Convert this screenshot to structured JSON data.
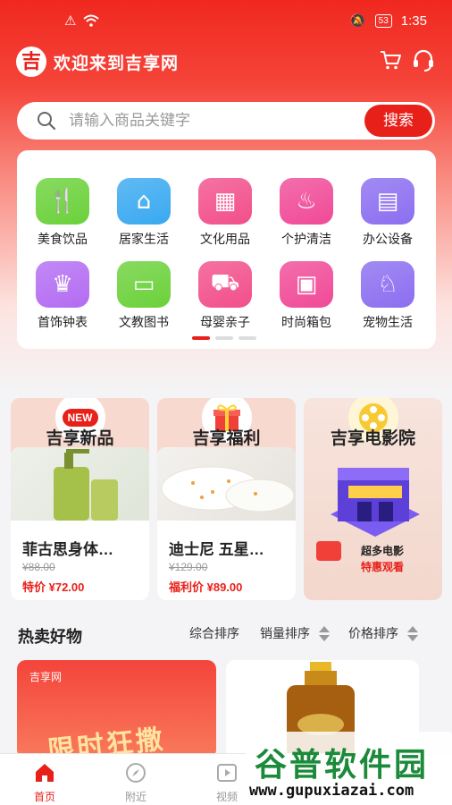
{
  "status": {
    "time": "1:35",
    "battery": "53"
  },
  "header": {
    "logo_char": "吉",
    "title": "欢迎来到吉享网"
  },
  "search": {
    "placeholder": "请输入商品关键字",
    "button": "搜索"
  },
  "categories": [
    {
      "label": "美食饮品",
      "icon": "utensils-icon",
      "color": "#6bd13a"
    },
    {
      "label": "居家生活",
      "icon": "home-icon",
      "color": "#39a9f0"
    },
    {
      "label": "文化用品",
      "icon": "calendar-icon",
      "color": "#f24f8a"
    },
    {
      "label": "个护清洁",
      "icon": "perfume-icon",
      "color": "#f04a97"
    },
    {
      "label": "办公设备",
      "icon": "office-icon",
      "color": "#8b6ef0"
    },
    {
      "label": "首饰钟表",
      "icon": "crown-icon",
      "color": "#b36cf2"
    },
    {
      "label": "文教图书",
      "icon": "book-icon",
      "color": "#6bd13a"
    },
    {
      "label": "母婴亲子",
      "icon": "stroller-icon",
      "color": "#f24f8a"
    },
    {
      "label": "时尚箱包",
      "icon": "luggage-icon",
      "color": "#f04a97"
    },
    {
      "label": "宠物生活",
      "icon": "pet-icon",
      "color": "#8b6ef0"
    }
  ],
  "promos": [
    {
      "title": "吉享新品",
      "badge": "NEW",
      "product": "菲古思身体…",
      "old_price": "¥88.00",
      "price": "特价 ¥72.00"
    },
    {
      "title": "吉享福利",
      "badge": "gift-icon",
      "product": "迪士尼 五星…",
      "old_price": "¥129.00",
      "price": "福利价 ¥89.00"
    },
    {
      "title": "吉享电影院",
      "badge": "film-reel-icon",
      "line1": "超多电影",
      "line2": "特惠观看"
    }
  ],
  "hot": {
    "title": "热卖好物",
    "sorts": [
      "综合排序",
      "销量排序",
      "价格排序"
    ],
    "banner_brand": "吉享网",
    "banner_text": "限时狂撒"
  },
  "tabs": [
    {
      "label": "首页",
      "icon": "home-icon",
      "active": true
    },
    {
      "label": "附近",
      "icon": "compass-icon",
      "active": false
    },
    {
      "label": "视频",
      "icon": "play-icon",
      "active": false
    }
  ],
  "watermark": {
    "text": "谷普软件园",
    "url": "www.gupuxiazai.com"
  }
}
